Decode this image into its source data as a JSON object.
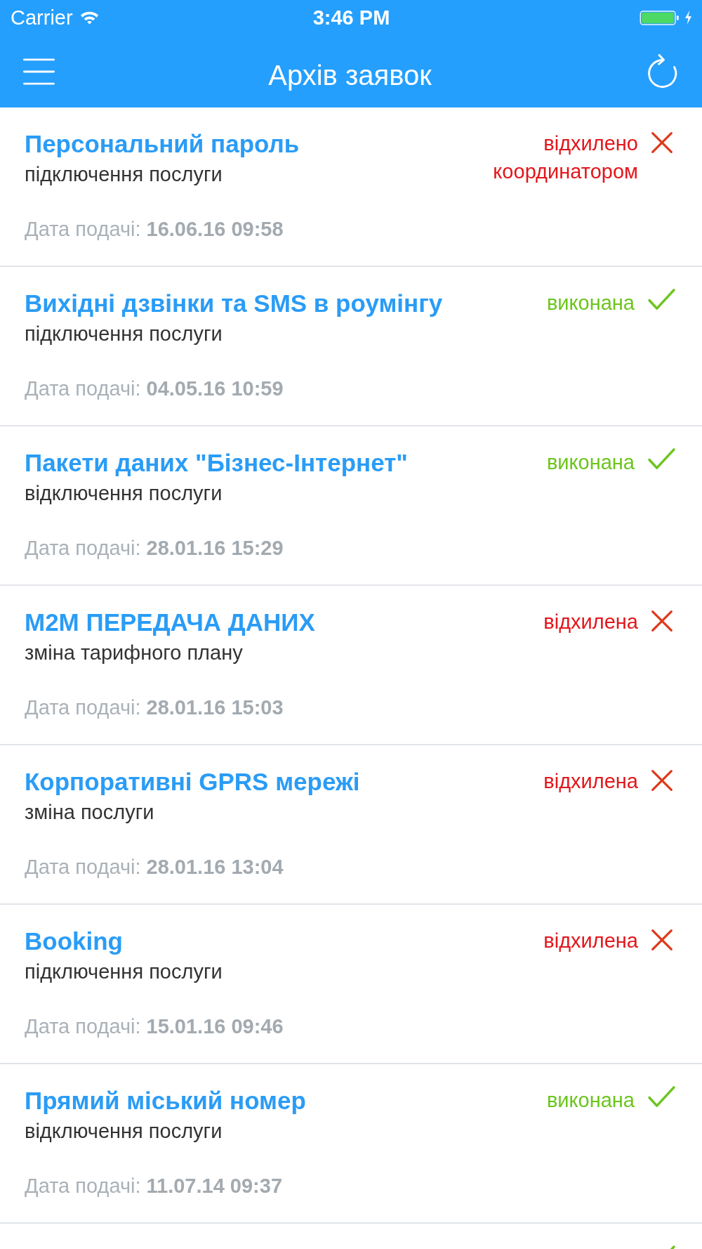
{
  "status_bar": {
    "carrier": "Carrier",
    "time": "3:46 PM"
  },
  "nav_bar": {
    "title": "Архів заявок"
  },
  "requests": [
    {
      "title": "Персональний пароль",
      "subtitle": "підключення послуги",
      "date_label": "Дата подачі:",
      "date": "16.06.16 09:58",
      "status": {
        "kind": "rejected",
        "label": "відхилено координатором"
      }
    },
    {
      "title": "Вихідні дзвінки та SMS в роумінгу",
      "subtitle": "підключення послуги",
      "date_label": "Дата подачі:",
      "date": "04.05.16 10:59",
      "status": {
        "kind": "done",
        "label": "виконана"
      }
    },
    {
      "title": "Пакети даних \"Бізнес-Інтернет\"",
      "subtitle": "відключення послуги",
      "date_label": "Дата подачі:",
      "date": "28.01.16 15:29",
      "status": {
        "kind": "done",
        "label": "виконана"
      }
    },
    {
      "title": "М2М ПЕРЕДАЧА ДАНИХ",
      "subtitle": "зміна тарифного плану",
      "date_label": "Дата подачі:",
      "date": "28.01.16 15:03",
      "status": {
        "kind": "rejected",
        "label": "відхилена"
      }
    },
    {
      "title": "Корпоративні GPRS мережі",
      "subtitle": "зміна послуги",
      "date_label": "Дата подачі:",
      "date": "28.01.16 13:04",
      "status": {
        "kind": "rejected",
        "label": "відхилена"
      }
    },
    {
      "title": "Booking",
      "subtitle": "підключення послуги",
      "date_label": "Дата подачі:",
      "date": "15.01.16 09:46",
      "status": {
        "kind": "rejected",
        "label": "відхилена"
      }
    },
    {
      "title": "Прямий міський номер",
      "subtitle": "відключення послуги",
      "date_label": "Дата подачі:",
      "date": "11.07.14 09:37",
      "status": {
        "kind": "done",
        "label": "виконана"
      }
    },
    {
      "status": {
        "kind": "done"
      }
    }
  ]
}
